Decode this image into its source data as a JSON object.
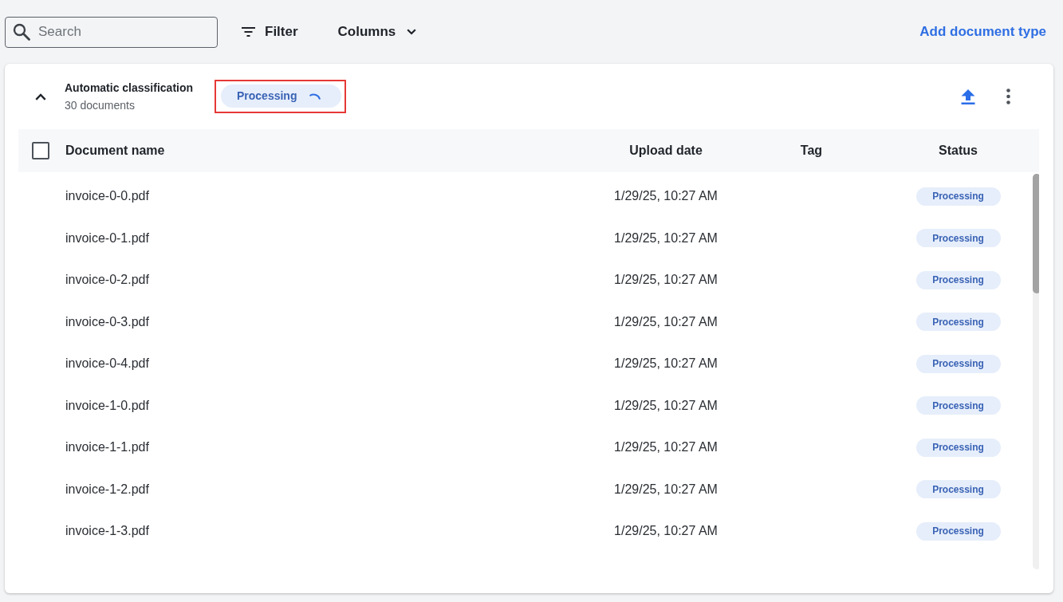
{
  "toolbar": {
    "search": {
      "placeholder": "Search"
    },
    "filter_button": "Filter",
    "columns_button": "Columns",
    "add_link": "Add document type"
  },
  "group": {
    "expanded": true,
    "title": "Automatic classification",
    "count": "30 documents",
    "status": "Processing",
    "loading": true,
    "highlighted": true
  },
  "table": {
    "select_all": {
      "checked": false
    },
    "columns": [
      "Document name",
      "Upload date",
      "Tag",
      "Status"
    ],
    "rows": [
      {
        "name": "invoice-0-0.pdf",
        "date": "1/29/25, 10:27 AM",
        "status": "Processing"
      },
      {
        "name": "invoice-0-1.pdf",
        "date": "1/29/25, 10:27 AM",
        "status": "Processing"
      },
      {
        "name": "invoice-0-2.pdf",
        "date": "1/29/25, 10:27 AM",
        "status": "Processing"
      },
      {
        "name": "invoice-0-3.pdf",
        "date": "1/29/25, 10:27 AM",
        "status": "Processing"
      },
      {
        "name": "invoice-0-4.pdf",
        "date": "1/29/25, 10:27 AM",
        "status": "Processing"
      },
      {
        "name": "invoice-1-0.pdf",
        "date": "1/29/25, 10:27 AM",
        "status": "Processing"
      },
      {
        "name": "invoice-1-1.pdf",
        "date": "1/29/25, 10:27 AM",
        "status": "Processing"
      },
      {
        "name": "invoice-1-2.pdf",
        "date": "1/29/25, 10:27 AM",
        "status": "Processing"
      },
      {
        "name": "invoice-1-3.pdf",
        "date": "1/29/25, 10:27 AM",
        "status": "Processing"
      }
    ]
  }
}
